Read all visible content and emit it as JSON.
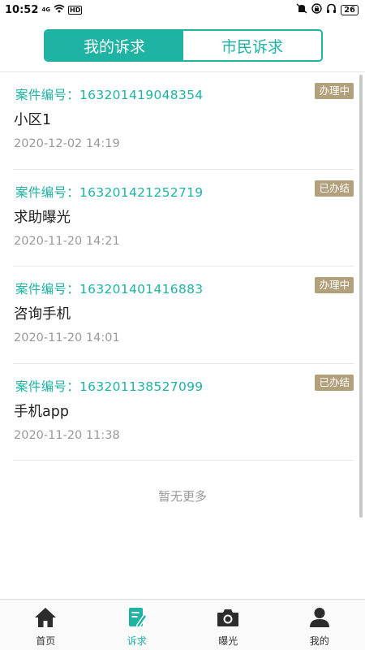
{
  "status_bar": {
    "time": "10:52",
    "network": "4G",
    "hd": "HD",
    "battery": "26"
  },
  "tabs": [
    {
      "label": "我的诉求",
      "active": true
    },
    {
      "label": "市民诉求",
      "active": false
    }
  ],
  "cases": [
    {
      "case_no": "案件编号：163201419048354",
      "title": "小区1",
      "date": "2020-12-02 14:19",
      "status": "办理中"
    },
    {
      "case_no": "案件编号：163201421252719",
      "title": "求助曝光",
      "date": "2020-11-20 14:21",
      "status": "已办结"
    },
    {
      "case_no": "案件编号：163201401416883",
      "title": "咨询手机",
      "date": "2020-11-20 14:01",
      "status": "办理中"
    },
    {
      "case_no": "案件编号：163201138527099",
      "title": "手机app",
      "date": "2020-11-20 11:38",
      "status": "已办结"
    }
  ],
  "no_more": "暂无更多",
  "nav": [
    {
      "label": "首页",
      "icon": "home-icon"
    },
    {
      "label": "诉求",
      "icon": "edit-note-icon"
    },
    {
      "label": "曝光",
      "icon": "camera-icon"
    },
    {
      "label": "我的",
      "icon": "person-icon"
    }
  ],
  "colors": {
    "accent": "#1eb3a2",
    "badge": "#b29f7c",
    "muted": "#999999"
  }
}
